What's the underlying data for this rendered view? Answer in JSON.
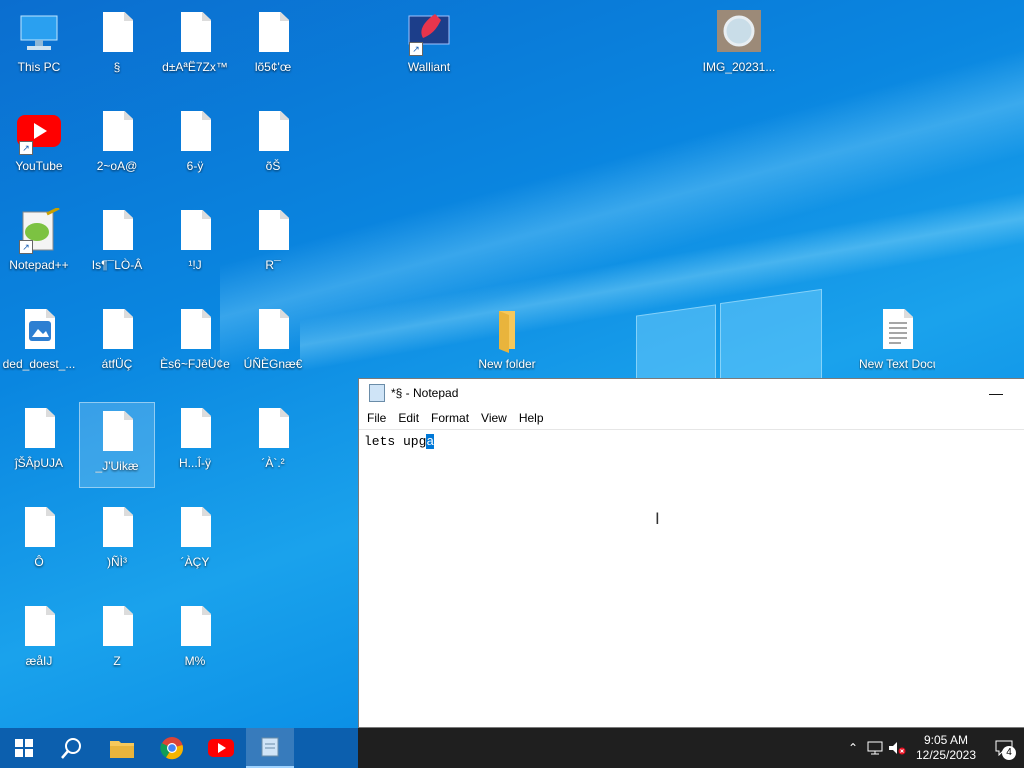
{
  "desktop": {
    "icons": [
      {
        "label": "This PC",
        "type": "pc"
      },
      {
        "label": "§",
        "type": "file"
      },
      {
        "label": "d±AªË7Zx™",
        "type": "file"
      },
      {
        "label": "lõ5¢'œ",
        "type": "file"
      },
      {
        "label": "Walliant",
        "type": "app"
      },
      {
        "label": "IMG_20231...",
        "type": "image"
      },
      {
        "label": "YouTube",
        "type": "youtube"
      },
      {
        "label": "2~oA@",
        "type": "file"
      },
      {
        "label": "6-ÿ",
        "type": "file"
      },
      {
        "label": "õŠ",
        "type": "file"
      },
      {
        "label": "Notepad++",
        "type": "notepadpp"
      },
      {
        "label": "Is¶¯LÒ-Â",
        "type": "file"
      },
      {
        "label": "¹!J",
        "type": "file"
      },
      {
        "label": "R¯",
        "type": "file"
      },
      {
        "label": "ded_doest_...",
        "type": "image"
      },
      {
        "label": "átfÜÇ",
        "type": "file"
      },
      {
        "label": "Ès6~FJêÙ¢e",
        "type": "file"
      },
      {
        "label": "ÚÑÈGnæ€",
        "type": "file"
      },
      {
        "label": "New folder",
        "type": "folder"
      },
      {
        "label": "New Text Document",
        "type": "textdoc"
      },
      {
        "label": "ĵŠÂpUJA",
        "type": "file"
      },
      {
        "label": "_J'Uikæ",
        "type": "file",
        "selected": true
      },
      {
        "label": "H...Î-ÿ",
        "type": "file"
      },
      {
        "label": "´À`.²",
        "type": "file"
      },
      {
        "label": "Ô",
        "type": "file"
      },
      {
        "label": ")ÑÌ³",
        "type": "file"
      },
      {
        "label": "´ÀÇY",
        "type": "file"
      },
      {
        "label": "æåIJ",
        "type": "file"
      },
      {
        "label": "Z",
        "type": "file"
      },
      {
        "label": "M%",
        "type": "file"
      }
    ]
  },
  "notepad": {
    "title": "*§ - Notepad",
    "minimize": "—",
    "menu": [
      "File",
      "Edit",
      "Format",
      "View",
      "Help"
    ],
    "text_before": "lets upg",
    "text_selected": "a"
  },
  "taskbar": {
    "apps": [
      "start",
      "search",
      "file-explorer",
      "chrome",
      "youtube",
      "notepad"
    ],
    "time": "9:05 AM",
    "date": "12/25/2023",
    "notification_count": "4"
  },
  "colors": {
    "taskbar": "#1f1f1f",
    "selection": "#0078d7",
    "youtube_red": "#ff0000",
    "folder": "#f6c85b"
  }
}
